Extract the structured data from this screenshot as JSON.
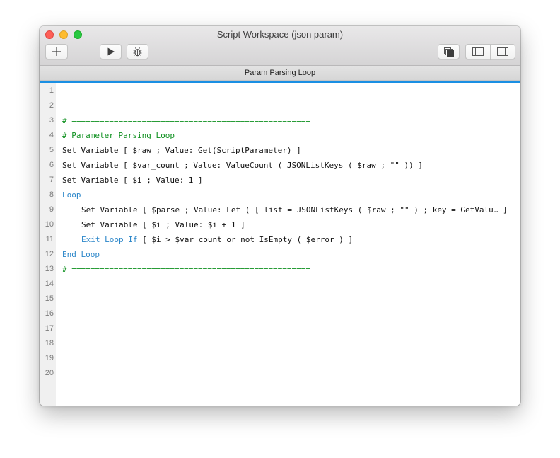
{
  "window": {
    "title": "Script Workspace (json param)"
  },
  "toolbar": {
    "buttons": [
      {
        "name": "add-script-button",
        "icon": "plus-icon"
      },
      {
        "name": "run-script-button",
        "icon": "play-icon"
      },
      {
        "name": "debug-script-button",
        "icon": "bug-icon"
      },
      {
        "name": "script-windows-button",
        "icon": "windows-icon"
      },
      {
        "name": "left-pane-button",
        "icon": "sidebar-left-icon"
      },
      {
        "name": "right-pane-button",
        "icon": "sidebar-right-icon"
      }
    ]
  },
  "tab": {
    "title": "Param Parsing Loop"
  },
  "colors": {
    "accent": "#1a8fe3",
    "comment": "#0c8f1d",
    "control": "#2b86c9",
    "text": "#111111",
    "line_number": "#7c7c7c"
  },
  "script": {
    "lines": [
      {
        "num": "1",
        "indent": 0,
        "parts": []
      },
      {
        "num": "2",
        "indent": 0,
        "parts": []
      },
      {
        "num": "3",
        "indent": 0,
        "parts": [
          {
            "t": "# ===================================================",
            "c": "comment"
          }
        ]
      },
      {
        "num": "4",
        "indent": 0,
        "parts": [
          {
            "t": "# Parameter Parsing Loop",
            "c": "comment"
          }
        ]
      },
      {
        "num": "5",
        "indent": 0,
        "parts": [
          {
            "t": "Set Variable [ $raw ; Value: Get(ScriptParameter) ]",
            "c": ""
          }
        ]
      },
      {
        "num": "6",
        "indent": 0,
        "parts": [
          {
            "t": "Set Variable [ $var_count ; Value: ValueCount ( JSONListKeys ( $raw ; \"\" )) ]",
            "c": ""
          }
        ]
      },
      {
        "num": "7",
        "indent": 0,
        "parts": [
          {
            "t": "Set Variable [ $i ; Value: 1 ]",
            "c": ""
          }
        ]
      },
      {
        "num": "8",
        "indent": 0,
        "parts": [
          {
            "t": "Loop",
            "c": "kw"
          }
        ]
      },
      {
        "num": "9",
        "indent": 1,
        "parts": [
          {
            "t": "Set Variable [ $parse ; Value: Let ( [ list = JSONListKeys ( $raw ; \"\" ) ; key = GetValu… ]",
            "c": ""
          }
        ]
      },
      {
        "num": "10",
        "indent": 1,
        "parts": [
          {
            "t": "Set Variable [ $i ; Value: $i + 1 ]",
            "c": ""
          }
        ]
      },
      {
        "num": "11",
        "indent": 1,
        "parts": [
          {
            "t": "Exit Loop If",
            "c": "kw"
          },
          {
            "t": " [ $i > $var_count or not IsEmpty ( $error ) ]",
            "c": ""
          }
        ]
      },
      {
        "num": "12",
        "indent": 0,
        "parts": [
          {
            "t": "End Loop",
            "c": "kw"
          }
        ]
      },
      {
        "num": "13",
        "indent": 0,
        "parts": [
          {
            "t": "# ===================================================",
            "c": "comment"
          }
        ]
      },
      {
        "num": "14",
        "indent": 0,
        "parts": []
      },
      {
        "num": "15",
        "indent": 0,
        "parts": []
      },
      {
        "num": "16",
        "indent": 0,
        "parts": []
      },
      {
        "num": "17",
        "indent": 0,
        "parts": []
      },
      {
        "num": "18",
        "indent": 0,
        "parts": []
      },
      {
        "num": "19",
        "indent": 0,
        "parts": []
      },
      {
        "num": "20",
        "indent": 0,
        "parts": []
      }
    ]
  }
}
